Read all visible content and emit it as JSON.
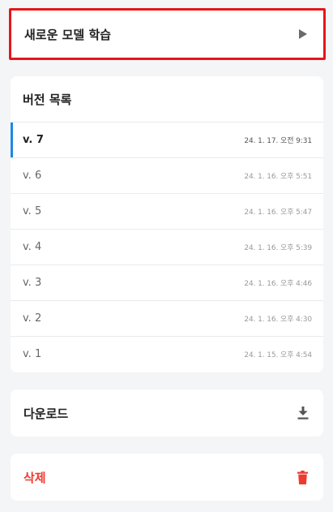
{
  "train": {
    "label": "새로운 모델 학습",
    "icon": "play-icon"
  },
  "versions": {
    "title": "버전 목록",
    "active_color": "#1e88e5",
    "items": [
      {
        "name": "v. 7",
        "date": "24. 1. 17. 오전 9:31",
        "active": true
      },
      {
        "name": "v. 6",
        "date": "24. 1. 16. 오후 5:51",
        "active": false
      },
      {
        "name": "v. 5",
        "date": "24. 1. 16. 오후 5:47",
        "active": false
      },
      {
        "name": "v. 4",
        "date": "24. 1. 16. 오후 5:39",
        "active": false
      },
      {
        "name": "v. 3",
        "date": "24. 1. 16. 오후 4:46",
        "active": false
      },
      {
        "name": "v. 2",
        "date": "24. 1. 16. 오후 4:30",
        "active": false
      },
      {
        "name": "v. 1",
        "date": "24. 1. 15. 오후 4:54",
        "active": false
      }
    ]
  },
  "download": {
    "label": "다운로드",
    "icon": "download-icon"
  },
  "delete": {
    "label": "삭제",
    "icon": "trash-icon",
    "color": "#ee3b31"
  },
  "highlight_color": "#e5161b"
}
